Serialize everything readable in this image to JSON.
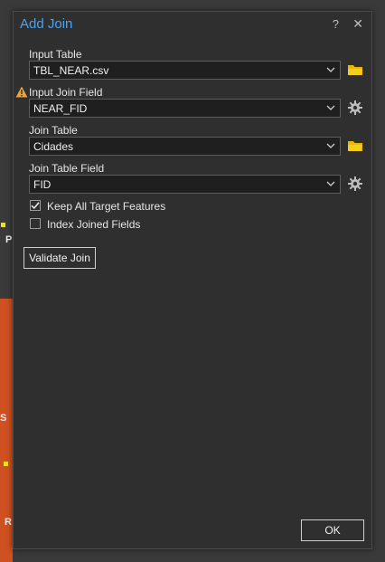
{
  "dialog": {
    "title": "Add Join",
    "help_label": "?",
    "close_label": "✕"
  },
  "fields": {
    "input_table": {
      "label": "Input Table",
      "value": "TBL_NEAR.csv"
    },
    "input_join_field": {
      "label": "Input Join Field",
      "value": "NEAR_FID"
    },
    "join_table": {
      "label": "Join Table",
      "value": "Cidades"
    },
    "join_table_field": {
      "label": "Join Table Field",
      "value": "FID"
    }
  },
  "options": {
    "keep_all": {
      "label": "Keep All Target Features",
      "checked": true
    },
    "index_joined": {
      "label": "Index Joined Fields",
      "checked": false
    }
  },
  "buttons": {
    "validate": "Validate Join",
    "ok": "OK"
  },
  "map_labels": [
    "P",
    "S",
    "R"
  ],
  "colors": {
    "accent": "#4aa3f0",
    "folder": "#e6b800",
    "warning": "#e8a33c",
    "map_feature": "#e0531f"
  }
}
